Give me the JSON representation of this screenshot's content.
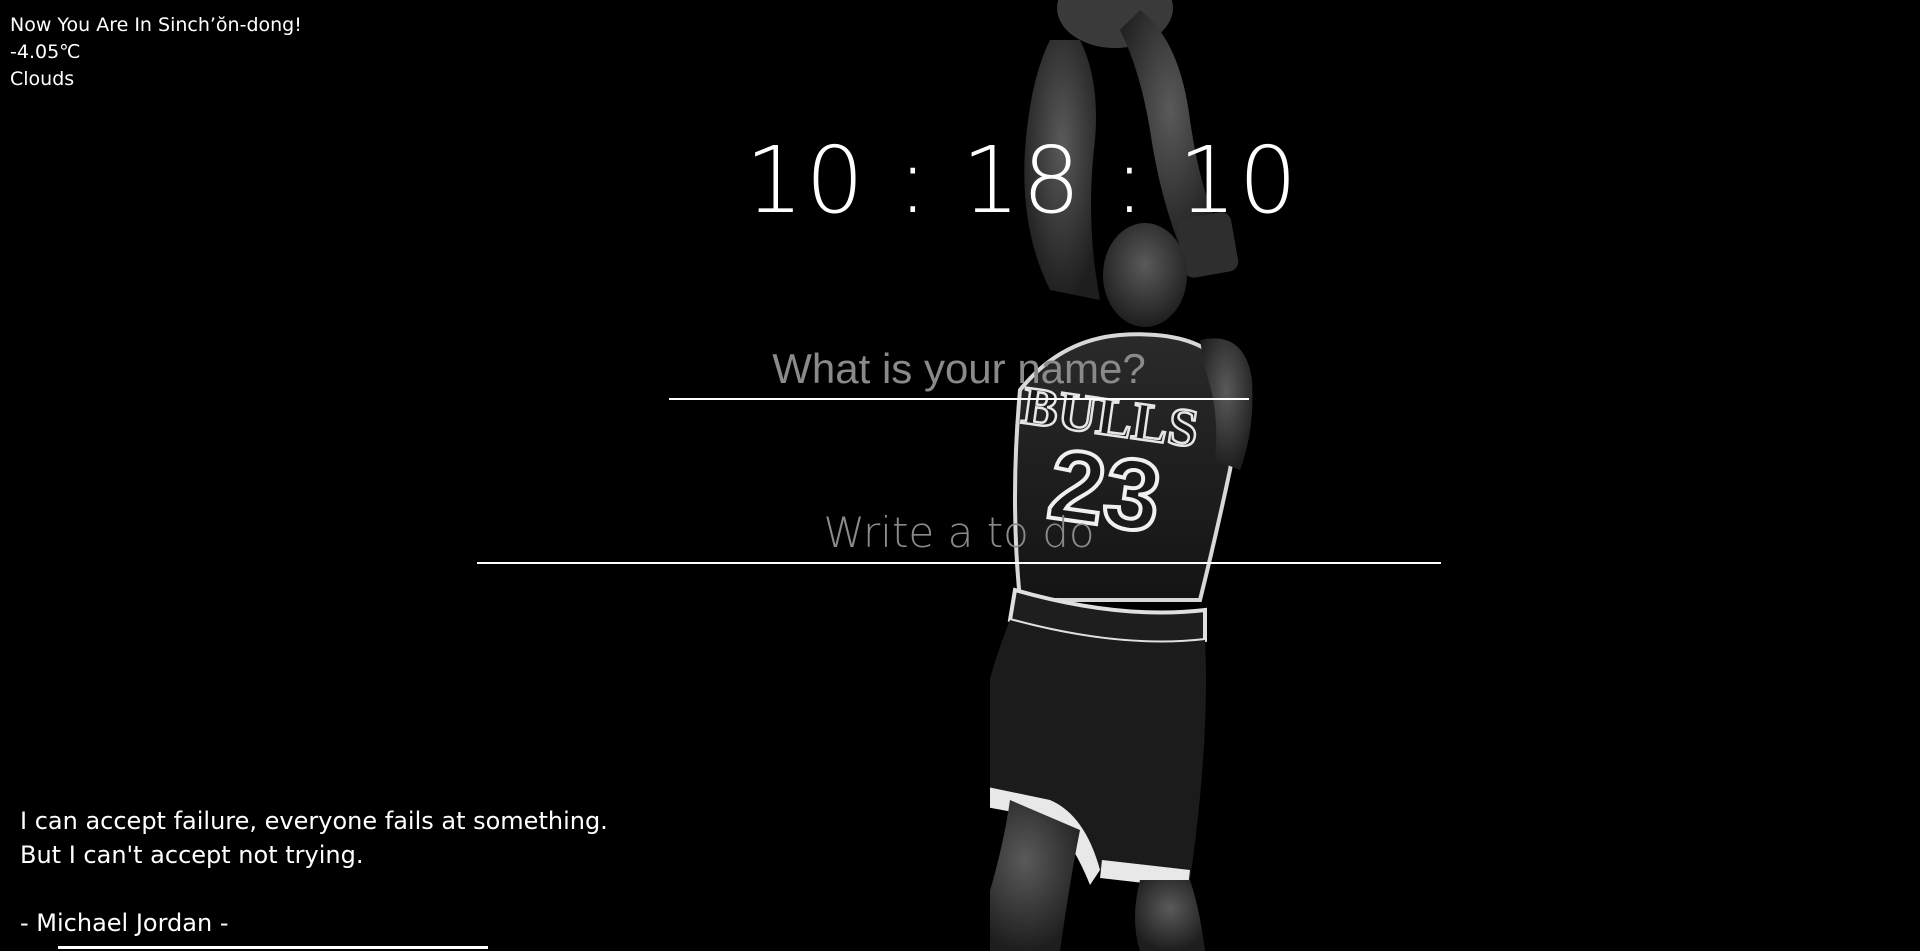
{
  "weather": {
    "location_text": "Now You Are In Sinch’ŏn-dong!",
    "temperature": "-4.05℃",
    "condition": "Clouds"
  },
  "clock": {
    "time": "10 : 18 : 10"
  },
  "name_form": {
    "placeholder": "What is your name?"
  },
  "todo_form": {
    "placeholder": "Write a to do"
  },
  "quote": {
    "line1": "I can accept failure, everyone fails at something.",
    "line2": "But I can't accept not trying.",
    "author": "- Michael Jordan -"
  },
  "background": {
    "jersey_text": "BULLS",
    "jersey_number": "23"
  }
}
